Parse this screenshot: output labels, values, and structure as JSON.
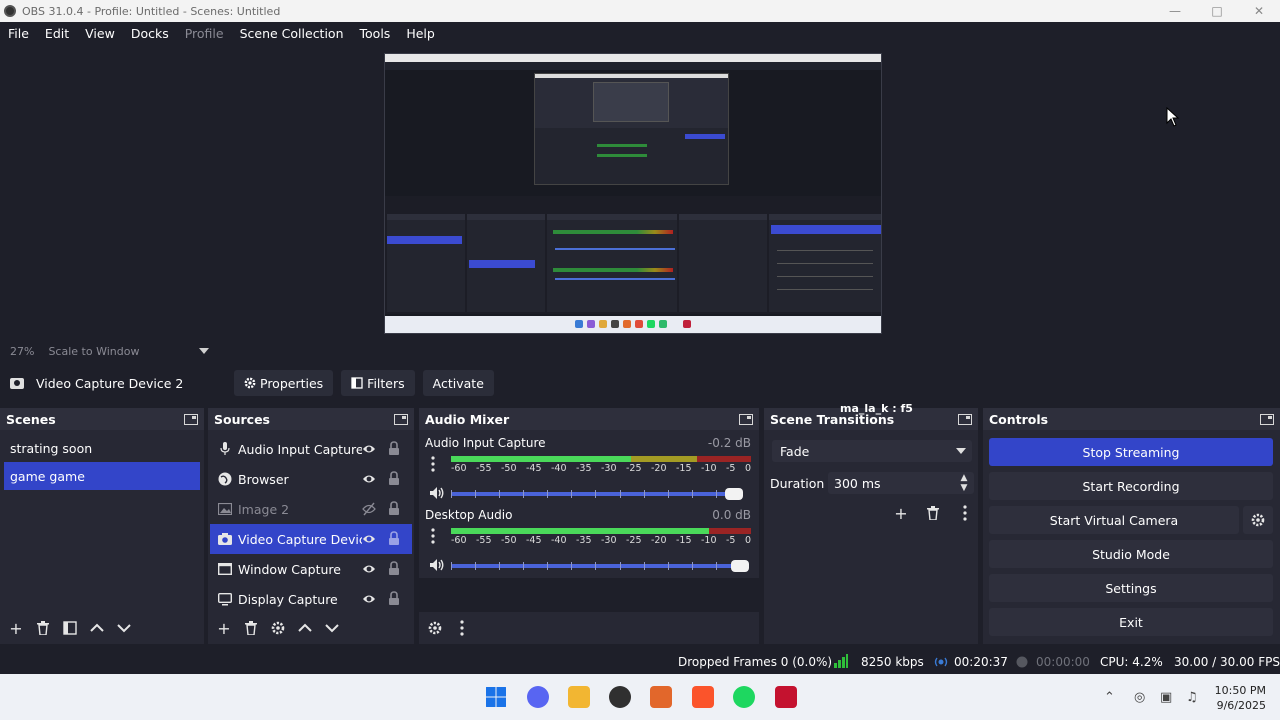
{
  "window": {
    "title": "OBS 31.0.4 - Profile: Untitled - Scenes: Untitled"
  },
  "menu": [
    "File",
    "Edit",
    "View",
    "Docks",
    "Profile",
    "Scene Collection",
    "Tools",
    "Help"
  ],
  "preview": {
    "zoom": "27%",
    "scale_mode": "Scale to Window"
  },
  "source_toolbar": {
    "source_name": "Video Capture Device 2",
    "properties": "Properties",
    "filters": "Filters",
    "activate": "Activate"
  },
  "scenes": {
    "title": "Scenes",
    "items": [
      {
        "label": "strating soon",
        "selected": false
      },
      {
        "label": "game game",
        "selected": true
      }
    ]
  },
  "sources": {
    "title": "Sources",
    "items": [
      {
        "label": "Audio Input Capture",
        "icon": "microphone-icon",
        "visible": true
      },
      {
        "label": "Browser",
        "icon": "globe-icon",
        "visible": true
      },
      {
        "label": "Image 2",
        "icon": "image-icon",
        "visible": false
      },
      {
        "label": "Video Capture Device 2",
        "icon": "camera-icon",
        "visible": true,
        "selected": true
      },
      {
        "label": "Window Capture",
        "icon": "window-icon",
        "visible": true
      },
      {
        "label": "Display Capture",
        "icon": "monitor-icon",
        "visible": true
      }
    ]
  },
  "mixer": {
    "title": "Audio Mixer",
    "ticks": [
      "-60",
      "-55",
      "-50",
      "-45",
      "-40",
      "-35",
      "-30",
      "-25",
      "-20",
      "-15",
      "-10",
      "-5",
      "0"
    ],
    "channels": [
      {
        "name": "Audio Input Capture",
        "db": "-0.2 dB",
        "level": 0.6,
        "volume": 1.0
      },
      {
        "name": "Desktop Audio",
        "db": "0.0 dB",
        "level": 0.86,
        "volume": 1.0
      }
    ]
  },
  "transitions": {
    "title": "Scene Transitions",
    "overlay_label": "ma_la_k : f5",
    "selected": "Fade",
    "duration_label": "Duration",
    "duration_value": "300 ms"
  },
  "controls": {
    "title": "Controls",
    "buttons": [
      "Stop Streaming",
      "Start Recording",
      "Start Virtual Camera",
      "Studio Mode",
      "Settings",
      "Exit"
    ]
  },
  "status": {
    "dropped_frames": "Dropped Frames 0 (0.0%)",
    "bitrate": "8250 kbps",
    "stream_time": "00:20:37",
    "record_time": "00:00:00",
    "cpu": "CPU: 4.2%",
    "fps": "30.00 / 30.00 FPS"
  },
  "taskbar": {
    "time": "10:50 PM",
    "date": "9/6/2025"
  },
  "colors": {
    "accent": "#3345c9",
    "background": "#1e1f29",
    "dock": "#272834"
  }
}
